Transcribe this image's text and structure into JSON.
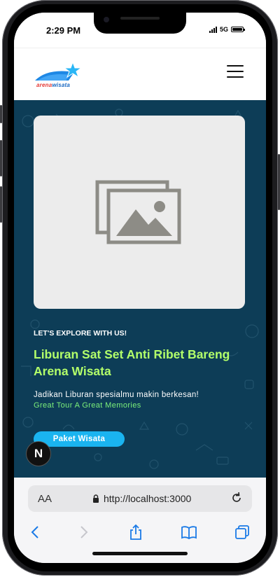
{
  "status_bar": {
    "time": "2:29 PM",
    "network": "5G",
    "icons": [
      "signal-icon",
      "battery-icon"
    ]
  },
  "header": {
    "logo_text_part1": "arena",
    "logo_text_part2": "wisata",
    "menu_icon": "hamburger-menu-icon"
  },
  "hero": {
    "image_icon": "image-placeholder-icon",
    "eyebrow": "LET'S EXPLORE WITH US!",
    "title": "Liburan Sat Set Anti Ribet Bareng Arena Wisata",
    "subtitle": "Jadikan Liburan spesialmu makin berkesan!",
    "tagline": "Great Tour A Great Memories",
    "cta_label": "Paket Wisata",
    "badge_letter": "N"
  },
  "browser": {
    "text_size_label": "AA",
    "url": "http://localhost:3000",
    "toolbar_icons": [
      "back-icon",
      "forward-icon",
      "share-icon",
      "bookmarks-icon",
      "tabs-icon"
    ]
  },
  "colors": {
    "hero_bg": "#0d3d57",
    "title_green": "#b3ff6a",
    "tagline_green": "#7cf07a",
    "cta_blue": "#1ab4f0",
    "toolbar_blue": "#1a7ae6"
  }
}
